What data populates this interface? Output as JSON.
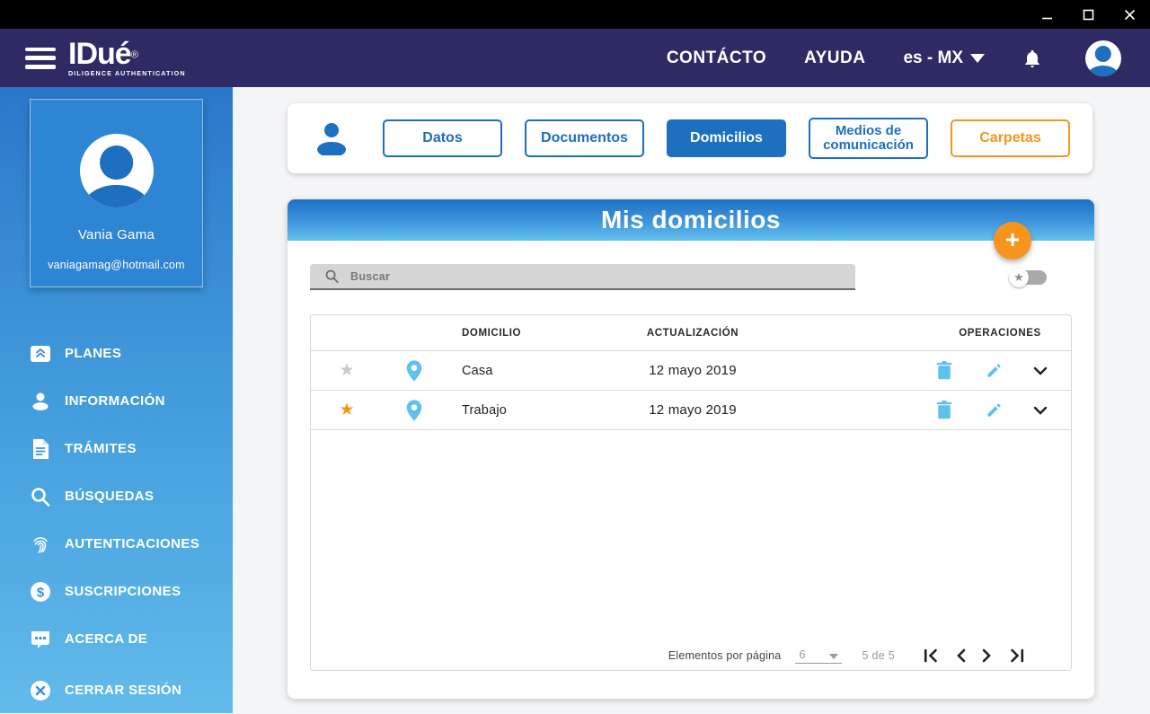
{
  "window": {
    "controls": {
      "minimize": "minimize",
      "maximize": "maximize",
      "close": "close"
    }
  },
  "header": {
    "logo": {
      "text": "IDué",
      "registered": "®",
      "subtitle": "DILIGENCE AUTHENTICATION"
    },
    "links": {
      "contact": "CONTÁCTO",
      "help": "AYUDA"
    },
    "language": "es - MX"
  },
  "sidebar": {
    "profile": {
      "name": "Vania Gama",
      "email": "vaniagamag@hotmail.com"
    },
    "items": [
      {
        "label": "PLANES",
        "icon": "plans-icon"
      },
      {
        "label": "INFORMACIÓN",
        "icon": "person-icon"
      },
      {
        "label": "TRÁMITES",
        "icon": "document-icon"
      },
      {
        "label": "BÚSQUEDAS",
        "icon": "search-icon"
      },
      {
        "label": "AUTENTICACIONES",
        "icon": "fingerprint-icon"
      },
      {
        "label": "SUSCRIPCIONES",
        "icon": "dollar-icon"
      },
      {
        "label": "ACERCA DE",
        "icon": "chat-icon"
      }
    ],
    "logout": {
      "label": "CERRAR SESIÓN"
    }
  },
  "tabs": [
    {
      "label": "Datos",
      "active": false,
      "style": "blue-outline"
    },
    {
      "label": "Documentos",
      "active": false,
      "style": "blue-outline"
    },
    {
      "label": "Domicilios",
      "active": true,
      "style": "blue-filled"
    },
    {
      "label": "Medios de comunicación",
      "active": false,
      "style": "blue-outline"
    },
    {
      "label": "Carpetas",
      "active": false,
      "style": "orange-outline"
    }
  ],
  "panel": {
    "title": "Mis domicilios",
    "add_button_label": "+",
    "search": {
      "placeholder": "Buscar"
    },
    "favorites_filter": {
      "state": "off",
      "icon": "star-icon"
    },
    "table": {
      "headers": {
        "domicilio": "DOMICILIO",
        "actualizacion": "ACTUALIZACIÓN",
        "operaciones": "OPERACIONES"
      },
      "rows": [
        {
          "favorite": false,
          "domicilio": "Casa",
          "actualizacion": "12 mayo 2019"
        },
        {
          "favorite": true,
          "domicilio": "Trabajo",
          "actualizacion": "12 mayo 2019"
        }
      ]
    },
    "pagination": {
      "items_per_page_label": "Elementos por página",
      "page_size": "6",
      "range": "5 de 5"
    }
  },
  "colors": {
    "titlebar": "#000000",
    "header": "#2e2a63",
    "accent_blue": "#1d6fc0",
    "light_blue_icon": "#5fc2ec",
    "orange": "#f7941e",
    "sidebar_gradient_top": "#2a77ca",
    "sidebar_gradient_bottom": "#62bbea",
    "panel_gradient_top": "#1e70c6",
    "panel_gradient_bottom": "#64c2ee"
  }
}
